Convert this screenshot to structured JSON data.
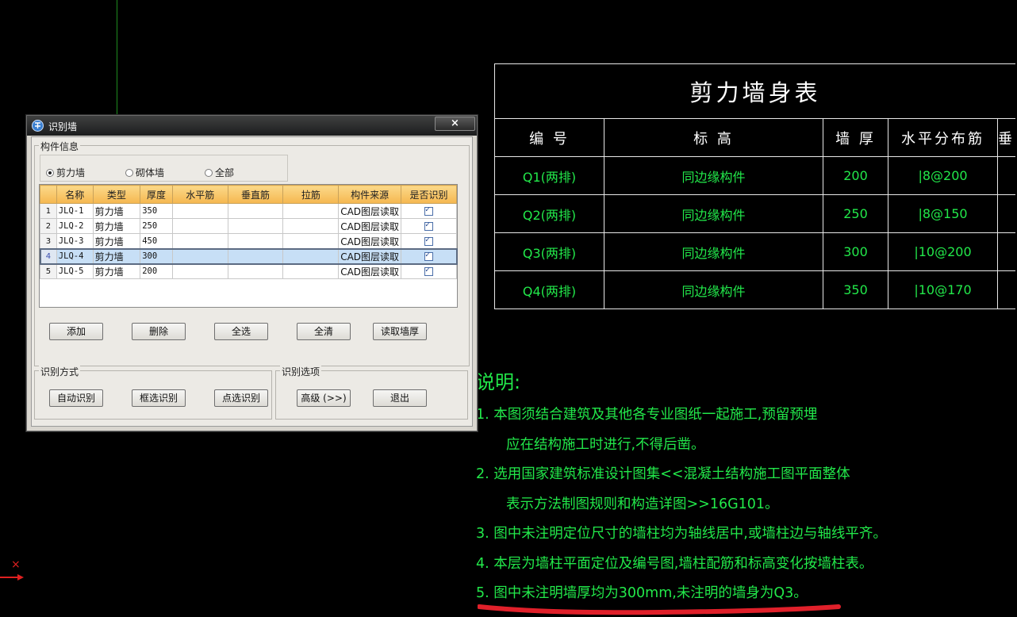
{
  "dialog": {
    "title": "识别墙",
    "close_label": "×",
    "group_info_label": "构件信息",
    "radios": [
      {
        "label": "剪力墙",
        "checked": true
      },
      {
        "label": "砌体墙",
        "checked": false
      },
      {
        "label": "全部",
        "checked": false
      }
    ],
    "columns": [
      "名称",
      "类型",
      "厚度",
      "水平筋",
      "垂直筋",
      "拉筋",
      "构件来源",
      "是否识别"
    ],
    "rows": [
      {
        "no": "1",
        "name": "JLQ-1",
        "type": "剪力墙",
        "thickness": "350",
        "h": "",
        "v": "",
        "tie": "",
        "source": "CAD图层读取",
        "recognize": true
      },
      {
        "no": "2",
        "name": "JLQ-2",
        "type": "剪力墙",
        "thickness": "250",
        "h": "",
        "v": "",
        "tie": "",
        "source": "CAD图层读取",
        "recognize": true
      },
      {
        "no": "3",
        "name": "JLQ-3",
        "type": "剪力墙",
        "thickness": "450",
        "h": "",
        "v": "",
        "tie": "",
        "source": "CAD图层读取",
        "recognize": true
      },
      {
        "no": "4",
        "name": "JLQ-4",
        "type": "剪力墙",
        "thickness": "300",
        "h": "",
        "v": "",
        "tie": "",
        "source": "CAD图层读取",
        "recognize": true
      },
      {
        "no": "5",
        "name": "JLQ-5",
        "type": "剪力墙",
        "thickness": "200",
        "h": "",
        "v": "",
        "tie": "",
        "source": "CAD图层读取",
        "recognize": true
      }
    ],
    "selected_row": 4,
    "buttons": {
      "add": "添加",
      "delete": "删除",
      "select_all": "全选",
      "clear_all": "全清",
      "read_thickness": "读取墙厚"
    },
    "mode_label": "识别方式",
    "options_label": "识别选项",
    "mode_buttons": {
      "auto": "自动识别",
      "box": "框选识别",
      "point": "点选识别"
    },
    "option_buttons": {
      "advanced": "高级 (>>)",
      "exit": "退出"
    }
  },
  "wall_table": {
    "title": "剪力墙身表",
    "headers": [
      "编 号",
      "标 高",
      "墙 厚",
      "水平分布筋",
      "垂"
    ],
    "rows": [
      {
        "id": "Q1(两排)",
        "elev": "同边缘构件",
        "thick": "200",
        "hbar": "|8@200"
      },
      {
        "id": "Q2(两排)",
        "elev": "同边缘构件",
        "thick": "250",
        "hbar": "|8@150"
      },
      {
        "id": "Q3(两排)",
        "elev": "同边缘构件",
        "thick": "300",
        "hbar": "|10@200"
      },
      {
        "id": "Q4(两排)",
        "elev": "同边缘构件",
        "thick": "350",
        "hbar": "|10@170"
      }
    ]
  },
  "notes": {
    "title": "说明:",
    "lines": [
      "1. 本图须结合建筑及其他各专业图纸一起施工,预留预埋",
      "应在结构施工时进行,不得后凿。",
      "2. 选用国家建筑标准设计图集<<混凝土结构施工图平面整体",
      "表示方法制图规则和构造详图>>16G101。",
      "3. 图中未注明定位尺寸的墙柱均为轴线居中,或墙柱边与轴线平齐。",
      "4. 本层为墙柱平面定位及编号图,墙柱配筋和标高变化按墙柱表。",
      "5. 图中未注明墙厚均为300mm,未注明的墙身为Q3。"
    ]
  },
  "ucs": {
    "x_label": "×"
  },
  "colors": {
    "cad_text": "#22e84a",
    "highlight": "#e0202a",
    "background": "#000000"
  }
}
